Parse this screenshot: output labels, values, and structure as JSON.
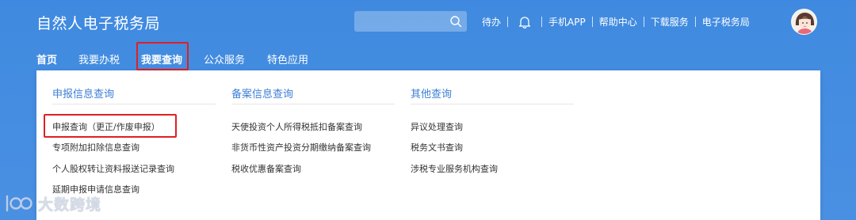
{
  "header": {
    "title": "自然人电子税务局",
    "search_placeholder": "",
    "links": {
      "todo": "待办",
      "mobile_app": "手机APP",
      "help": "帮助中心",
      "download": "下载服务",
      "e_tax": "电子税务局"
    }
  },
  "nav": {
    "items": [
      {
        "label": "首页",
        "active": true
      },
      {
        "label": "我要办税",
        "active": false
      },
      {
        "label": "我要查询",
        "active": false
      },
      {
        "label": "公众服务",
        "active": false
      },
      {
        "label": "特色应用",
        "active": false
      }
    ]
  },
  "dropdown": {
    "columns": [
      {
        "title": "申报信息查询",
        "items": [
          "申报查询（更正/作废申报）",
          "专项附加扣除信息查询",
          "个人股权转让资料报送记录查询",
          "延期申报申请信息查询"
        ]
      },
      {
        "title": "备案信息查询",
        "items": [
          "天使投资个人所得税抵扣备案查询",
          "非货币性资产投资分期缴纳备案查询",
          "税收优惠备案查询"
        ]
      },
      {
        "title": "其他查询",
        "items": [
          "异议处理查询",
          "税务文书查询",
          "涉税专业服务机构查询"
        ]
      }
    ]
  },
  "watermark": {
    "text": "大数跨境"
  },
  "colors": {
    "header_bg": "#4a90e2",
    "accent": "#3d7fd6",
    "highlight": "#e02020"
  }
}
